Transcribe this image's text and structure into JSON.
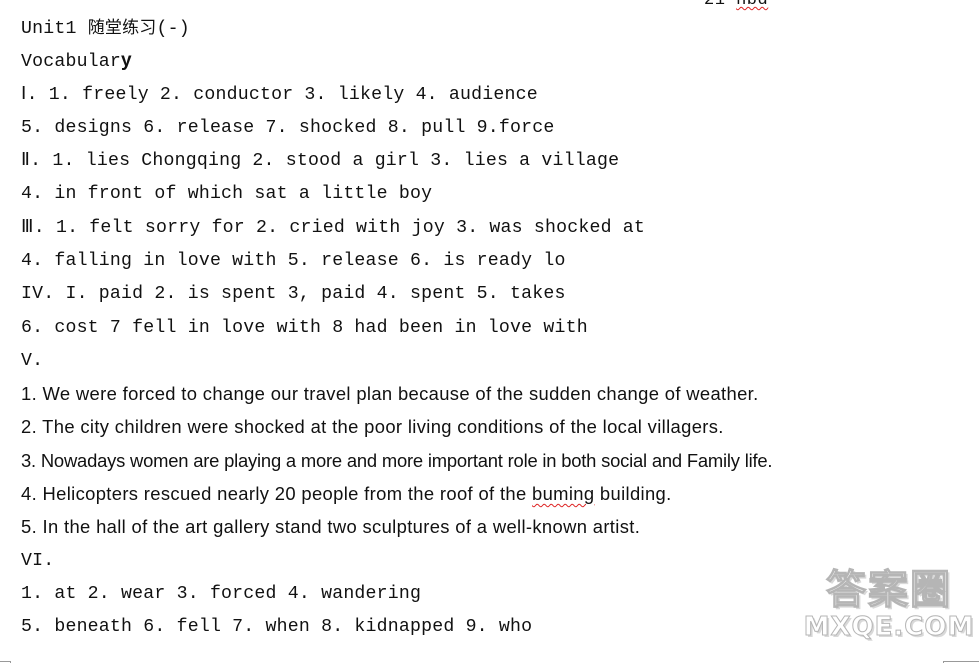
{
  "top_fragment": {
    "text": "21 ",
    "misspelled": "hbd"
  },
  "title": {
    "prefix": "Unit1 ",
    "cjk": "随堂练习",
    "suffix": "(-)"
  },
  "section_heading": {
    "text_main": "Vocabular",
    "text_tail": "y"
  },
  "lines": [
    "Ⅰ. 1. freely 2. conductor 3. likely 4. audience",
    "5. designs 6. release 7. shocked 8. pull 9.force",
    "Ⅱ. 1. lies Chongqing 2. stood a girl 3. lies a village",
    "4. in front of which sat a little boy",
    "Ⅲ. 1. felt sorry for 2. cried with joy 3. was shocked at",
    "4. falling in love with 5. release 6. is ready lo",
    "IV. I. paid 2. is spent 3, paid 4. spent 5. takes",
    "6. cost 7 fell in love with 8 had been in love with",
    "V."
  ],
  "sentences": [
    "1. We were forced to change our travel plan because of the sudden change of weather.",
    "2. The city children were shocked at the poor living conditions of the local villagers.",
    "3. Nowadays women are playing a more and more important role in both social and Family life."
  ],
  "sentence_4": {
    "before": "4. Helicopters rescued nearly 20 people from the roof of the ",
    "misspelled": "buming",
    "after": " building."
  },
  "sentence_5": "5. In the hall of the art gallery stand two sculptures of a well-known artist.",
  "section_vi": {
    "heading": "VI.",
    "lines": [
      "1. at 2. wear 3. forced 4. wandering",
      "5. beneath 6. fell 7. when 8. kidnapped 9. who"
    ]
  },
  "watermark": {
    "cn": "答案圈",
    "en": "MXQE.COM"
  }
}
